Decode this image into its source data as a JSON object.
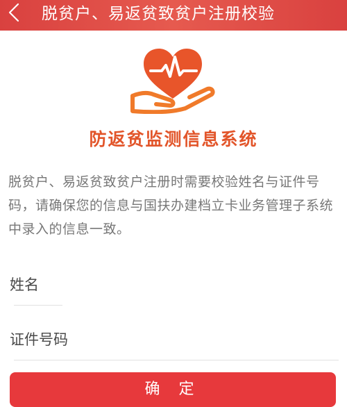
{
  "header": {
    "title": "脱贫户、易返贫致贫户注册校验",
    "back_icon": "chevron-left-icon"
  },
  "logo": {
    "icon": "heart-hand-icon",
    "colors": {
      "heart": "#e8552a",
      "pulse": "#ffffff",
      "hand": "#f07a2a"
    }
  },
  "system_name": "防返贫监测信息系统",
  "notice": "脱贫户、易返贫致贫户注册时需要校验姓名与证件号码，请确保您的信息与国扶办建档立卡业务管理子系统中录入的信息一致。",
  "form": {
    "name_placeholder": "姓名",
    "id_placeholder": "证件号码",
    "confirm_label": "确 定"
  },
  "colors": {
    "header_bg": "#d9413f",
    "accent": "#e2552a",
    "button_bg": "#e7393c"
  }
}
